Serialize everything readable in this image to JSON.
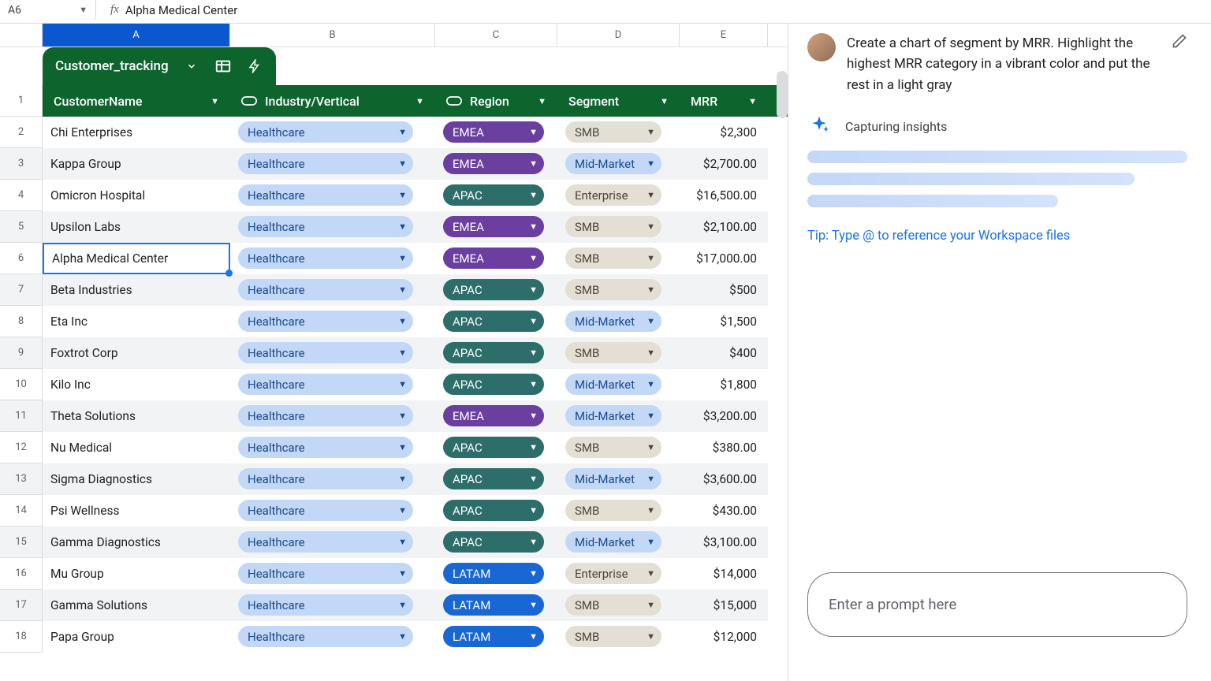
{
  "formula": {
    "cellRef": "A6",
    "value": "Alpha Medical Center"
  },
  "columns": [
    "A",
    "B",
    "C",
    "D",
    "E"
  ],
  "tab": {
    "name": "Customer_tracking"
  },
  "headers": {
    "a": "CustomerName",
    "b": "Industry/Vertical",
    "c": "Region",
    "d": "Segment",
    "e": "MRR"
  },
  "rows": [
    {
      "n": "2",
      "name": "Chi Enterprises",
      "ind": "Healthcare",
      "reg": "EMEA",
      "regc": "emea",
      "seg": "SMB",
      "segc": "smb",
      "mrr": "$2,300"
    },
    {
      "n": "3",
      "name": "Kappa Group",
      "ind": "Healthcare",
      "reg": "EMEA",
      "regc": "emea",
      "seg": "Mid-Market",
      "segc": "mm",
      "mrr": "$2,700.00"
    },
    {
      "n": "4",
      "name": "Omicron Hospital",
      "ind": "Healthcare",
      "reg": "APAC",
      "regc": "apac",
      "seg": "Enterprise",
      "segc": "ent",
      "mrr": "$16,500.00"
    },
    {
      "n": "5",
      "name": "Upsilon Labs",
      "ind": "Healthcare",
      "reg": "EMEA",
      "regc": "emea",
      "seg": "SMB",
      "segc": "smb",
      "mrr": "$2,100.00"
    },
    {
      "n": "6",
      "name": "Alpha Medical Center",
      "ind": "Healthcare",
      "reg": "EMEA",
      "regc": "emea",
      "seg": "SMB",
      "segc": "smb",
      "mrr": "$17,000.00",
      "sel": true
    },
    {
      "n": "7",
      "name": "Beta Industries",
      "ind": "Healthcare",
      "reg": "APAC",
      "regc": "apac",
      "seg": "SMB",
      "segc": "smb",
      "mrr": "$500"
    },
    {
      "n": "8",
      "name": "Eta Inc",
      "ind": "Healthcare",
      "reg": "APAC",
      "regc": "apac",
      "seg": "Mid-Market",
      "segc": "mm",
      "mrr": "$1,500"
    },
    {
      "n": "9",
      "name": "Foxtrot Corp",
      "ind": "Healthcare",
      "reg": "APAC",
      "regc": "apac",
      "seg": "SMB",
      "segc": "smb",
      "mrr": "$400"
    },
    {
      "n": "10",
      "name": "Kilo Inc",
      "ind": "Healthcare",
      "reg": "APAC",
      "regc": "apac",
      "seg": "Mid-Market",
      "segc": "mm",
      "mrr": "$1,800"
    },
    {
      "n": "11",
      "name": "Theta Solutions",
      "ind": "Healthcare",
      "reg": "EMEA",
      "regc": "emea",
      "seg": "Mid-Market",
      "segc": "mm",
      "mrr": "$3,200.00"
    },
    {
      "n": "12",
      "name": "Nu Medical",
      "ind": "Healthcare",
      "reg": "APAC",
      "regc": "apac",
      "seg": "SMB",
      "segc": "smb",
      "mrr": "$380.00"
    },
    {
      "n": "13",
      "name": "Sigma Diagnostics",
      "ind": "Healthcare",
      "reg": "APAC",
      "regc": "apac",
      "seg": "Mid-Market",
      "segc": "mm",
      "mrr": "$3,600.00"
    },
    {
      "n": "14",
      "name": "Psi Wellness",
      "ind": "Healthcare",
      "reg": "APAC",
      "regc": "apac",
      "seg": "SMB",
      "segc": "smb",
      "mrr": "$430.00"
    },
    {
      "n": "15",
      "name": "Gamma Diagnostics",
      "ind": "Healthcare",
      "reg": "APAC",
      "regc": "apac",
      "seg": "Mid-Market",
      "segc": "mm",
      "mrr": "$3,100.00"
    },
    {
      "n": "16",
      "name": "Mu Group",
      "ind": "Healthcare",
      "reg": "LATAM",
      "regc": "latam",
      "seg": "Enterprise",
      "segc": "ent",
      "mrr": "$14,000"
    },
    {
      "n": "17",
      "name": "Gamma Solutions",
      "ind": "Healthcare",
      "reg": "LATAM",
      "regc": "latam",
      "seg": "SMB",
      "segc": "smb",
      "mrr": "$15,000"
    },
    {
      "n": "18",
      "name": "Papa Group",
      "ind": "Healthcare",
      "reg": "LATAM",
      "regc": "latam",
      "seg": "SMB",
      "segc": "smb",
      "mrr": "$12,000"
    }
  ],
  "side": {
    "prompt": "Create a chart of segment by MRR. Highlight the highest MRR category in a vibrant color and put the rest in a light gray",
    "status": "Capturing insights",
    "tip": "Tip: Type @ to reference your Workspace files",
    "placeholder": "Enter a prompt here"
  }
}
